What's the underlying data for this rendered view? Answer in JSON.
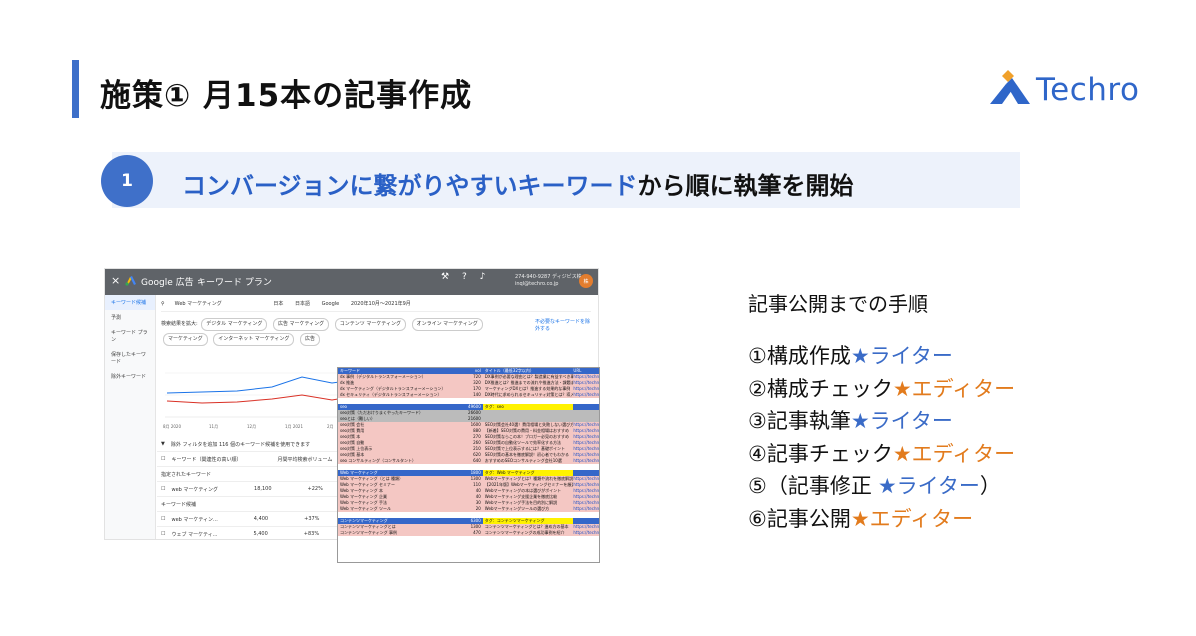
{
  "header": {
    "title": "施策①  月15本の記事作成",
    "logo_text": "Techro",
    "accent_color": "#3d6fc9"
  },
  "banner": {
    "step_number": "1",
    "text_blue": "コンバージョンに繋がりやすいキーワード",
    "text_black": "から順に執筆を開始"
  },
  "screenshot": {
    "close": "×",
    "product": "Google 広告",
    "tool": "キーワード プラン",
    "account_line1": "274-940-9287 ディジビス株",
    "account_line2": "inql@techro.co.jp",
    "avatar": "株",
    "sidebar": [
      "キーワード候補",
      "予測",
      "キーワード プラン",
      "保存したキーワード",
      "除外キーワード"
    ],
    "search_term": "Web マーケティング",
    "location": "日本",
    "language": "日本語",
    "network": "Google",
    "date_range": "2020年10月〜2021年9月",
    "chips_label": "検索結果を拡大:",
    "chips": [
      "デジタル マーケティング",
      "広告 マーケティング",
      "コンテンツ マーケティング",
      "オンライン マーケティング",
      "マーケティング",
      "インターネット マーケティング",
      "広告"
    ],
    "chips_link": "不必要なキーワードを除外する",
    "chart_ticks": [
      "8月 2020",
      "11月",
      "12月",
      "1月 2021",
      "2月"
    ],
    "filter_text": "除外 フィルタを追加  116 個のキーワード候補を使用できます",
    "col_keyword": "キーワード（関連性の高い順）",
    "col_volume": "月間平均検索ボリューム",
    "group_label": "指定されたキーワード",
    "rows": [
      {
        "kw": "web マーケティング",
        "vol": "18,100",
        "chg": "+22%"
      },
      {
        "kw": "web マーケティン...",
        "vol": "4,400",
        "chg": "+37%"
      },
      {
        "kw": "ウェブ マーケティ...",
        "vol": "5,400",
        "chg": "+83%"
      }
    ],
    "candidates_label": "キーワード候補"
  },
  "sheet": {
    "header": [
      "キーワード",
      "vol",
      "タイトル（最低32字以内）",
      "URL"
    ],
    "rows": [
      {
        "type": "pink",
        "c1": "dx 事例（デジタルトランスフォーメーション）",
        "c2": "720",
        "c3": "DX事例が必要な理由とは？製造業に有益すべき事項",
        "c4": "https://techro.co"
      },
      {
        "type": "pink",
        "c1": "dx 推進",
        "c2": "320",
        "c3": "DX推進とは？推進までの流れや推進方法・課題まで",
        "c4": "https://techro.co"
      },
      {
        "type": "pink",
        "c1": "dx マーケティング（デジタルトランスフォーメーション）",
        "c2": "170",
        "c3": "マーケティングDXとは？推進する効果的な事例",
        "c4": "https://techro.co"
      },
      {
        "type": "pink",
        "c1": "dx セキュリティ（デジタルトランスフォーメーション）",
        "c2": "140",
        "c3": "DX時代に求められるセキュリティ対策とは？導入方法",
        "c4": "https://techro.co"
      },
      {
        "type": "blank",
        "c1": "",
        "c2": "",
        "c3": "",
        "c4": ""
      },
      {
        "type": "hdr",
        "c1": "seo",
        "c2": "49600",
        "c3": "タグ：seo",
        "c4": ""
      },
      {
        "type": "grey",
        "c1": "seo対策（ただおけりまくやったキーワード）",
        "c2": "26600",
        "c3": "",
        "c4": ""
      },
      {
        "type": "grey",
        "c1": "seoとは（難しい）",
        "c2": "21600",
        "c3": "",
        "c4": ""
      },
      {
        "type": "pink",
        "c1": "seo対策 会社",
        "c2": "1600",
        "c3": "SEO対策会社40選！費用相場と失敗しない選び方",
        "c4": "https://techro.co"
      },
      {
        "type": "pink",
        "c1": "seo対策 費用",
        "c2": "880",
        "c3": "【新着】SEO対策の費用・料金相場はおすすめ",
        "c4": "https://techro.co"
      },
      {
        "type": "pink",
        "c1": "seo対策 本",
        "c2": "270",
        "c3": "SEO対策ならこの本！ブロガー必見のおすすめ",
        "c4": "https://techro.co"
      },
      {
        "type": "pink",
        "c1": "seo対策 自動",
        "c2": "260",
        "c3": "SEO対策の自動化ツールで効率化する方法",
        "c4": "https://techro.co"
      },
      {
        "type": "pink",
        "c1": "seo対策 上位表示",
        "c2": "210",
        "c3": "SEO対策で上位表示するには？基礎ポイント",
        "c4": "https://techro.co"
      },
      {
        "type": "pink",
        "c1": "seo対策 基本",
        "c2": "620",
        "c3": "SEO対策の基本を徹底解説！初心者でもわかる",
        "c4": "https://techro.co"
      },
      {
        "type": "pink",
        "c1": "seo コンサルティング（コンサルタント）",
        "c2": "640",
        "c3": "おすすめのSEOコンサルティング会社10選",
        "c4": "https://techro.co"
      },
      {
        "type": "blank",
        "c1": "",
        "c2": "",
        "c3": "",
        "c4": ""
      },
      {
        "type": "hdr",
        "c1": "Web マーケティング",
        "c2": "1800",
        "c3": "タグ：Web マーケティング",
        "c4": ""
      },
      {
        "type": "pink",
        "c1": "Web マーケティング（とは 種類）",
        "c2": "1300",
        "c3": "Webマーケティングとは？種類や流れを徹底解説",
        "c4": "https://techro.co"
      },
      {
        "type": "pink",
        "c1": "Web マーケティング セミナー",
        "c2": "110",
        "c3": "【2021年版】Webマーケティングセミナーを厳選",
        "c4": "https://techro.co"
      },
      {
        "type": "pink",
        "c1": "Web マーケティング 本",
        "c2": "40",
        "c3": "Webマーケティングの本は選びがポイント",
        "c4": "https://techro.co"
      },
      {
        "type": "pink",
        "c1": "Web マーケティング 企業",
        "c2": "40",
        "c3": "Webマーケティング支援企業を徹底比較",
        "c4": "https://techro.co"
      },
      {
        "type": "pink",
        "c1": "Web マーケティング 手法",
        "c2": "30",
        "c3": "Webマーケティング手法を目的別に解説",
        "c4": "https://techro.co"
      },
      {
        "type": "pink",
        "c1": "Web マーケティング ツール",
        "c2": "20",
        "c3": "Webマーケティングツールの選び方",
        "c4": "https://techro.co"
      },
      {
        "type": "blank",
        "c1": "",
        "c2": "",
        "c3": "",
        "c4": ""
      },
      {
        "type": "hdr",
        "c1": "コンテンツマーケティング",
        "c2": "6300",
        "c3": "タグ：コンテンツマーケティング",
        "c4": ""
      },
      {
        "type": "pink",
        "c1": "コンテンツマーケティングとは",
        "c2": "1300",
        "c3": "コンテンツマーケティングとは？進め方の基本",
        "c4": "https://techro.co"
      },
      {
        "type": "pink",
        "c1": "コンテンツマーケティング 事例",
        "c2": "470",
        "c3": "コンテンツマーケティングの成功事例を紹介",
        "c4": "https://techro.co"
      }
    ]
  },
  "process": {
    "title": "記事公開までの手順",
    "steps": [
      {
        "text": "①構成作成",
        "role": "★ライター",
        "color": "#3a6bc7"
      },
      {
        "text": "②構成チェック",
        "role": "★エディター",
        "color": "#e27b1d"
      },
      {
        "text": "③記事執筆",
        "role": "★ライター",
        "color": "#3a6bc7"
      },
      {
        "text": "④記事チェック",
        "role": "★エディター",
        "color": "#e27b1d"
      },
      {
        "text": "⑤（記事修正",
        "role": "★ライター",
        "suffix": "）",
        "color": "#3a6bc7"
      },
      {
        "text": "⑥記事公開",
        "role": "★エディター",
        "color": "#e27b1d"
      }
    ]
  }
}
